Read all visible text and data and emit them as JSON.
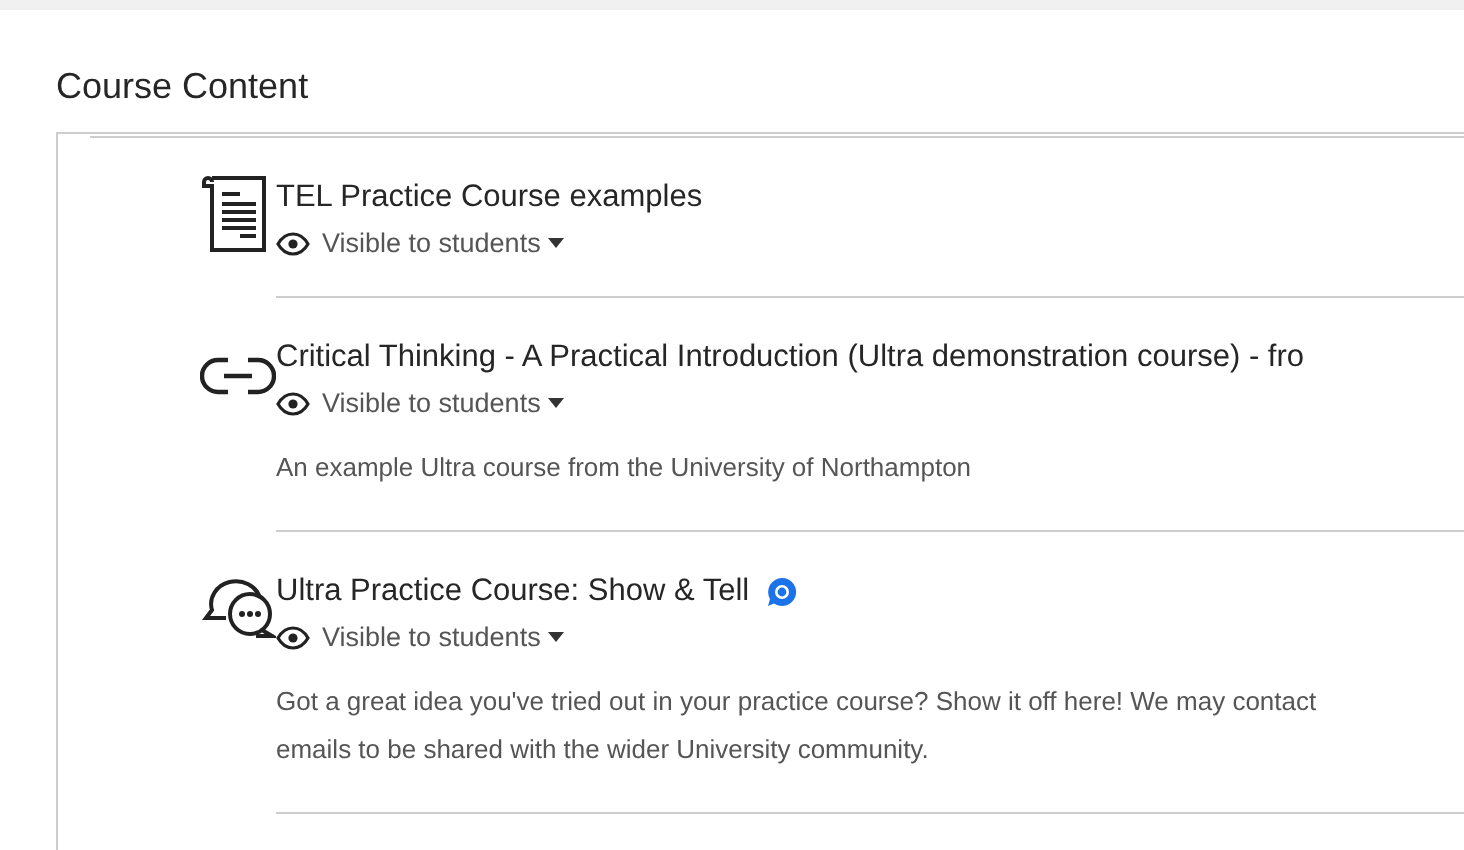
{
  "heading": "Course Content",
  "items": [
    {
      "kind": "document",
      "title": "TEL Practice Course examples",
      "visibility": "Visible to students",
      "badge": false
    },
    {
      "kind": "link",
      "title": "Critical Thinking - A Practical Introduction (Ultra demonstration course) - fro",
      "visibility": "Visible to students",
      "badge": false,
      "description": [
        "An example Ultra course from the University of Northampton"
      ]
    },
    {
      "kind": "discussion",
      "title": "Ultra Practice Course: Show & Tell",
      "visibility": "Visible to students",
      "badge": true,
      "description": [
        "Got a great idea you've tried out in your practice course? Show it off here! We may contact",
        "emails to be shared with the wider University community."
      ]
    }
  ]
}
